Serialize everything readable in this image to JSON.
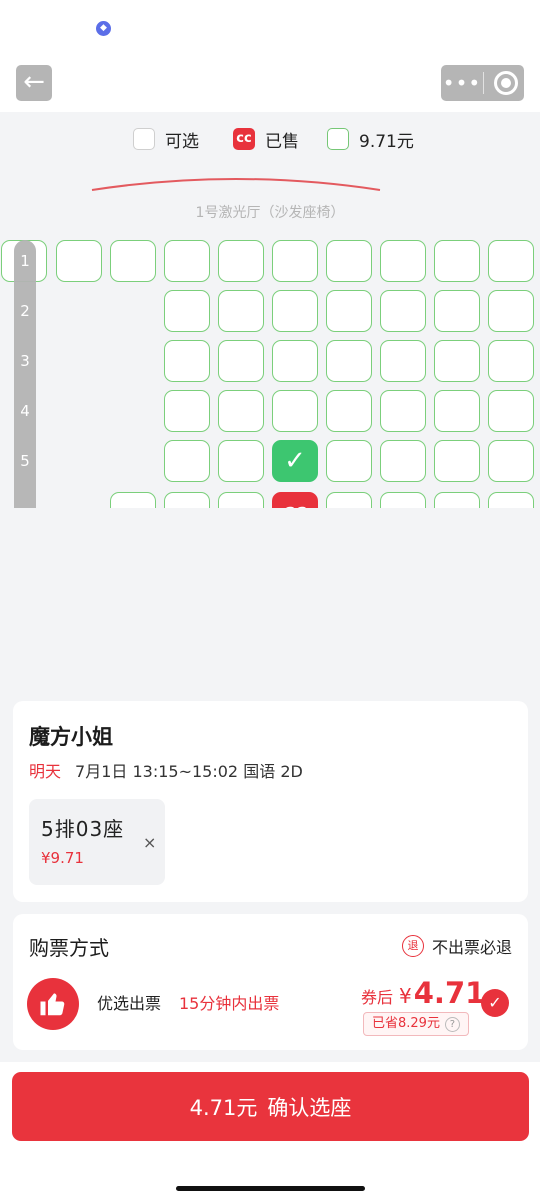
{
  "status": {
    "app_icon": "cube-icon"
  },
  "nav": {
    "back_glyph": "←",
    "menu_glyph": "•••"
  },
  "legend": {
    "available": "可选",
    "sold": "已售",
    "price": "9.71元",
    "sold_glyph": "cc"
  },
  "hall": {
    "name": "1号激光厅（沙发座椅）"
  },
  "seat_map": {
    "rows": [
      "1",
      "2",
      "3",
      "4",
      "5"
    ],
    "selected_glyph": "✓",
    "sold_glyph": "cc",
    "colors": {
      "available_border": "#7bcf7b",
      "selected": "#3dc670",
      "sold": "#e8323c"
    }
  },
  "movie": {
    "title": "魔方小姐",
    "day": "明天",
    "date": "7月1日",
    "time": "13:15~15:02",
    "language": "国语",
    "format": "2D",
    "selected_seat": {
      "position": "5排03座",
      "price": "¥9.71",
      "remove_glyph": "×"
    }
  },
  "purchase": {
    "title": "购票方式",
    "refund_badge": "退",
    "refund_text": "不出票必退",
    "option_label": "优选出票",
    "option_time": "15分钟内出票",
    "after_coupon_label": "券后",
    "currency": "¥",
    "price_after": "4.71",
    "saved_text": "已省8.29元",
    "help_glyph": "?",
    "check_glyph": "✓"
  },
  "confirm": {
    "price": "4.71元",
    "label": "确认选座"
  },
  "colors": {
    "accent": "#e8323c",
    "available": "#7bcf7b",
    "selected": "#3dc670"
  }
}
